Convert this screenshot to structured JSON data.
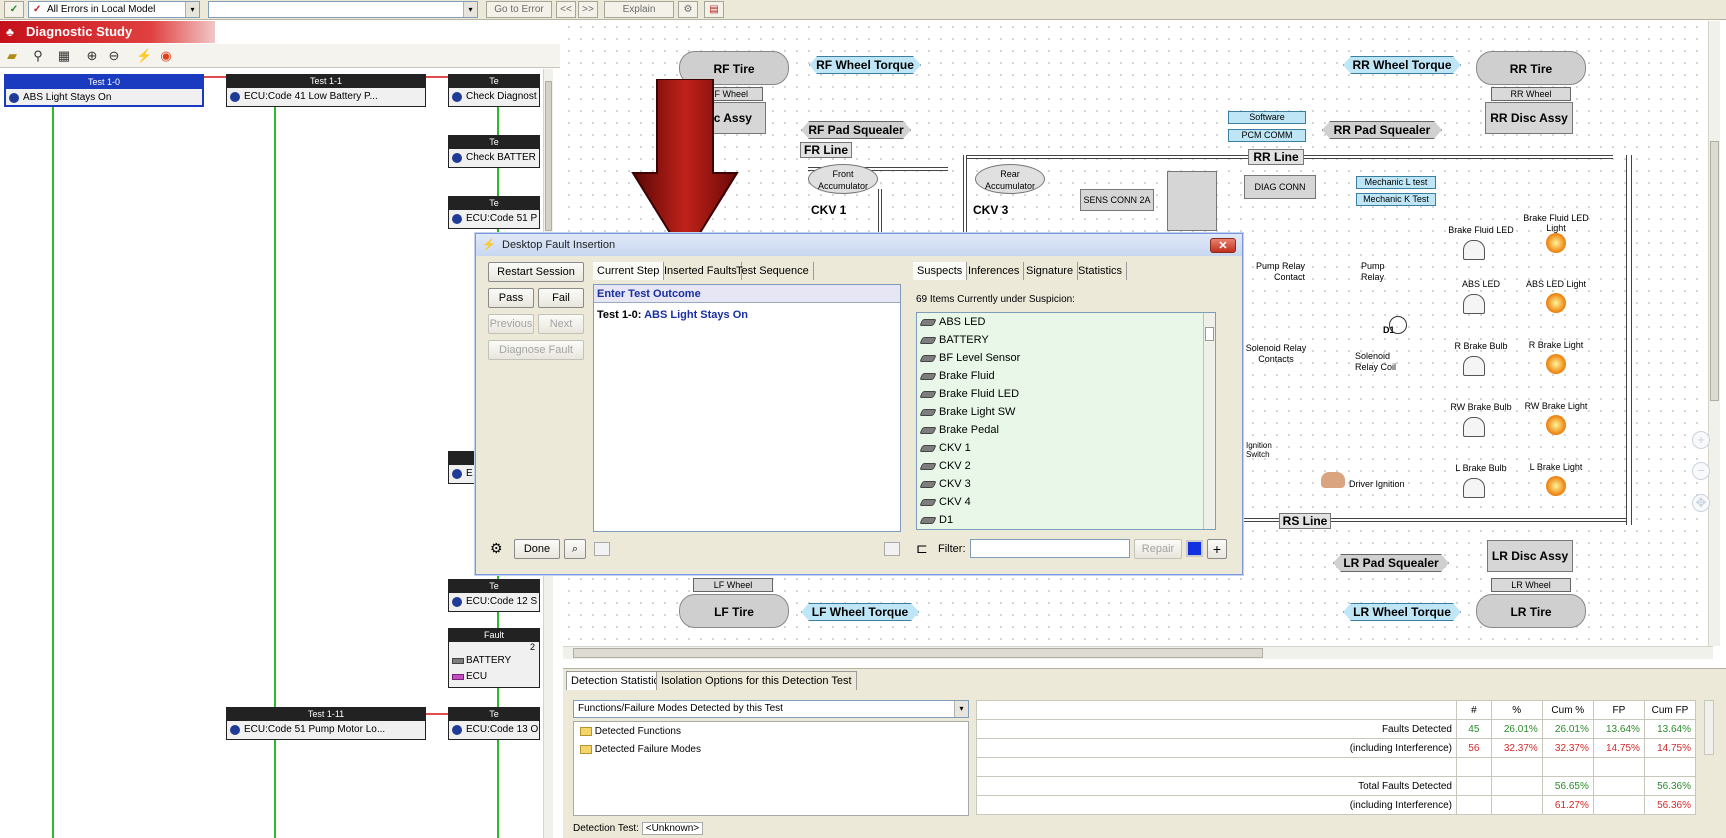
{
  "toolbar": {
    "filter_value": "All Errors in Local Model",
    "go_to_error": "Go to Error",
    "explain": "Explain",
    "prev_symbol": "<<",
    "next_symbol": ">>"
  },
  "left_panel": {
    "title": "Diagnostic Study",
    "nodes": [
      {
        "header": "Test 1-0",
        "label": "ABS Light Stays On"
      },
      {
        "header": "Test 1-1",
        "label": "ECU:Code 41 Low Battery P..."
      },
      {
        "header": "Te",
        "label": "Check Diagnost"
      },
      {
        "header": "Te",
        "label": "Check BATTER"
      },
      {
        "header": "Te",
        "label": "ECU:Code 51 P"
      },
      {
        "header": "",
        "label": "E"
      },
      {
        "header": "Te",
        "label": "ECU:Code 12 S"
      },
      {
        "header": "Fault",
        "sub": "2",
        "items": [
          "BATTERY",
          "ECU"
        ]
      },
      {
        "header": "Test 1-11",
        "label": "ECU:Code 51 Pump Motor Lo..."
      },
      {
        "header": "Te",
        "label": "ECU:Code 13 O"
      }
    ]
  },
  "diagram": {
    "tires": {
      "rf": "RF Tire",
      "rr": "RR Tire",
      "lf": "LF Tire",
      "lr": "LR Tire"
    },
    "wheels": {
      "rf": "RF Wheel",
      "rr": "RR Wheel",
      "lf": "LF Wheel",
      "lr": "LR Wheel"
    },
    "torques": {
      "rf": "RF Wheel Torque",
      "rr": "RR Wheel Torque",
      "lf": "LF Wheel Torque",
      "lr": "LR Wheel Torque"
    },
    "disc": {
      "rf": "Disc Assy",
      "rr": "RR Disc Assy",
      "lr": "LR Disc Assy"
    },
    "squealers": {
      "rf": "RF Pad Squealer",
      "rr": "RR Pad Squealer",
      "lr": "LR Pad Squealer"
    },
    "lines": {
      "fr": "FR Line",
      "rr": "RR Line",
      "rs": "RS Line"
    },
    "accumulators": {
      "front": "Front Accumulator",
      "rear": "Rear Accumulator"
    },
    "ckv": {
      "ckv1": "CKV 1",
      "ckv3": "CKV 3"
    },
    "blue_tags": {
      "software": "Software",
      "pcm": "PCM COMM",
      "mech_l": "Mechanic L test",
      "mech_k": "Mechanic K Test"
    },
    "boxes": {
      "sens": "SENS CONN 2A",
      "diag": "DIAG CONN"
    },
    "pump": {
      "contact": "Pump Relay Contact",
      "relay": "Pump Relay"
    },
    "solenoid": {
      "contacts": "Solenoid Relay Contacts",
      "coil": "Solenoid Relay Coil"
    },
    "ignition": {
      "switch": "Ignition Switch",
      "driver": "Driver Ignition"
    },
    "leds": [
      "Brake Fluid LED",
      "ABS LED",
      "R Brake Bulb",
      "RW Brake Bulb",
      "L Brake Bulb"
    ],
    "lights": [
      "Brake Fluid LED Light",
      "ABS LED Light",
      "R Brake Light",
      "RW Brake Light",
      "L Brake Light"
    ],
    "d1": "D1"
  },
  "dialog": {
    "title": "Desktop Fault Insertion",
    "close": "✕",
    "buttons": {
      "restart": "Restart Session",
      "pass": "Pass",
      "fail": "Fail",
      "previous": "Previous",
      "next": "Next",
      "diagnose": "Diagnose Fault",
      "done": "Done",
      "repair": "Repair"
    },
    "left_tabs": [
      "Current Step",
      "Inserted Faults",
      "Test Sequence"
    ],
    "right_tabs": [
      "Suspects",
      "Inferences",
      "Signature",
      "Statistics"
    ],
    "prompt": "Enter Test Outcome",
    "test_prefix": "Test 1-0:",
    "test_name": "ABS Light Stays On",
    "suspicion_count": "69 Items Currently under Suspicion:",
    "suspects": [
      "ABS LED",
      "BATTERY",
      "BF Level Sensor",
      "Brake Fluid",
      "Brake Fluid LED",
      "Brake Light SW",
      "Brake Pedal",
      "CKV 1",
      "CKV 2",
      "CKV 3",
      "CKV 4",
      "D1"
    ],
    "filter_label": "Filter:"
  },
  "bottom": {
    "tabs": [
      "Detection Statistics",
      "Isolation Options for this Detection Test"
    ],
    "dropdown": "Functions/Failure Modes Detected by this Test",
    "folders": [
      "Detected Functions",
      "Detected Failure Modes"
    ],
    "stats_headers": [
      "#",
      "%",
      "Cum %",
      "FP",
      "Cum FP"
    ],
    "stats_rows": [
      {
        "label": "Faults Detected",
        "count": "45",
        "pct": "26.01%",
        "cum": "26.01%",
        "fp": "13.64%",
        "cumfp": "13.64%",
        "color": "green"
      },
      {
        "label": "(including Interference)",
        "count": "56",
        "pct": "32.37%",
        "cum": "32.37%",
        "fp": "14.75%",
        "cumfp": "14.75%",
        "color": "red"
      },
      {
        "label": "",
        "count": "",
        "pct": "",
        "cum": "",
        "fp": "",
        "cumfp": "",
        "color": "green"
      },
      {
        "label": "Total Faults Detected",
        "count": "",
        "pct": "",
        "cum": "56.65%",
        "fp": "",
        "cumfp": "56.36%",
        "color": "green"
      },
      {
        "label": "(including Interference)",
        "count": "",
        "pct": "",
        "cum": "61.27%",
        "fp": "",
        "cumfp": "56.36%",
        "color": "red"
      }
    ],
    "detection_test_label": "Detection Test:",
    "detection_test_value": "<Unknown>"
  }
}
